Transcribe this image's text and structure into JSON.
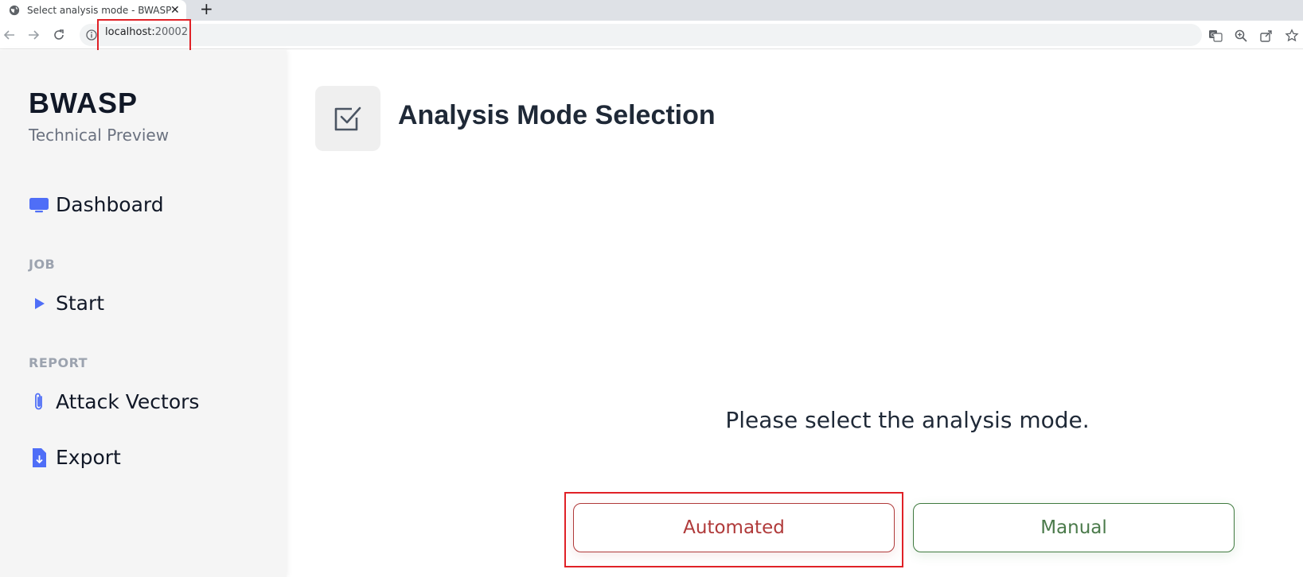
{
  "browser": {
    "tab_title": "Select analysis mode - BWASP",
    "tab_close": "✕",
    "new_tab": "+",
    "url_host": "localhost:",
    "url_port": "20002"
  },
  "sidebar": {
    "brand": "BWASP",
    "subtitle": "Technical Preview",
    "items": [
      {
        "label": "Dashboard",
        "icon": "monitor-icon"
      },
      {
        "label": "Start",
        "icon": "play-icon"
      },
      {
        "label": "Attack Vectors",
        "icon": "paperclip-icon"
      },
      {
        "label": "Export",
        "icon": "file-download-icon"
      }
    ],
    "sections": [
      "JOB",
      "REPORT"
    ]
  },
  "main": {
    "title": "Analysis Mode Selection",
    "header_icon": "checkbox-icon",
    "prompt": "Please select the analysis mode.",
    "buttons": {
      "automated": "Automated",
      "manual": "Manual"
    }
  },
  "colors": {
    "accent": "#4f6ef7",
    "automated": "#b03a3a",
    "manual": "#3f7a3f",
    "highlight": "#e02127"
  }
}
